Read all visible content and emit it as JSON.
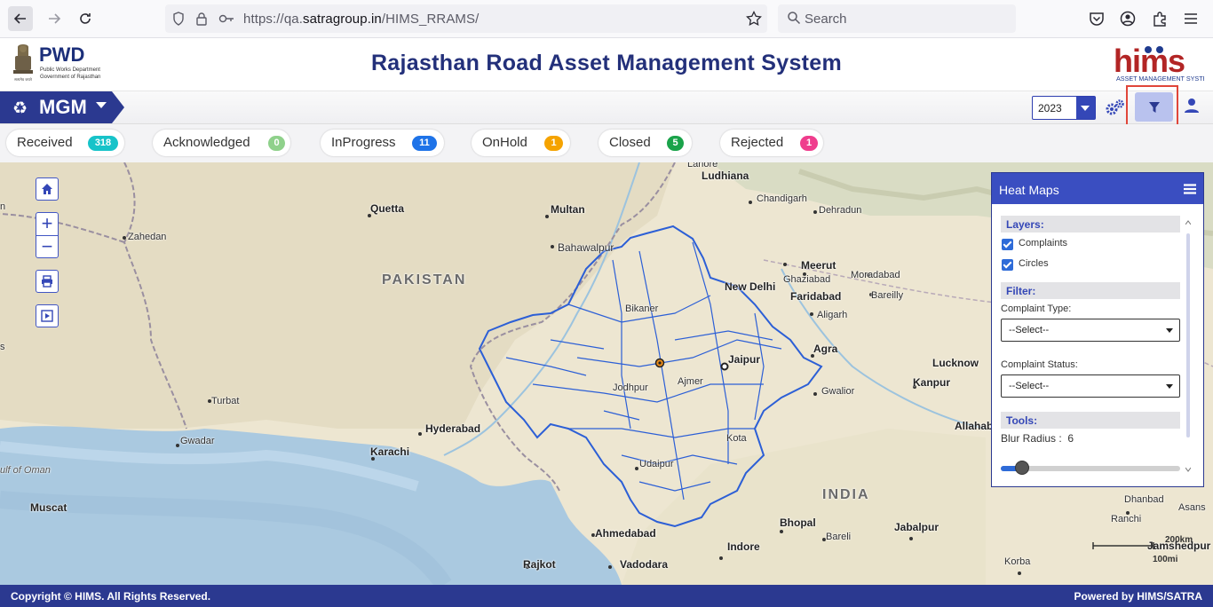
{
  "browser": {
    "url_prefix": "https://qa.",
    "url_domain": "satragroup.in",
    "url_path": "/HIMS_RRAMS/",
    "search_placeholder": "Search"
  },
  "header": {
    "org_name": "PWD",
    "org_sub1": "Public Works Department",
    "org_sub2": "Government of Rajasthan",
    "title": "Rajasthan Road Asset Management System",
    "logo_text": "hims",
    "logo_tagline": "ASSET MANAGEMENT SYSTEM"
  },
  "toolbar": {
    "module": "MGM",
    "year": "2023"
  },
  "statuses": [
    {
      "label": "Received",
      "count": "318",
      "color": "#17c3c9"
    },
    {
      "label": "Acknowledged",
      "count": "0",
      "color": "#8fd18b"
    },
    {
      "label": "InProgress",
      "count": "11",
      "color": "#1e73e8"
    },
    {
      "label": "OnHold",
      "count": "1",
      "color": "#f5a300"
    },
    {
      "label": "Closed",
      "count": "5",
      "color": "#1aa34a"
    },
    {
      "label": "Rejected",
      "count": "1",
      "color": "#ef3d8d"
    }
  ],
  "map": {
    "places": [
      {
        "name": "Ludhiana",
        "bold": true
      },
      {
        "name": "Chandigarh"
      },
      {
        "name": "Dehradun"
      },
      {
        "name": "Quetta",
        "bold": true
      },
      {
        "name": "Multan",
        "bold": true
      },
      {
        "name": "Zahedan"
      },
      {
        "name": "Bahawalpur"
      },
      {
        "name": "PAKISTAN",
        "country": true
      },
      {
        "name": "Meerut",
        "bold": true
      },
      {
        "name": "Moradabad"
      },
      {
        "name": "New Delhi",
        "bold": true
      },
      {
        "name": "Ghaziabad"
      },
      {
        "name": "Faridabad",
        "bold": true
      },
      {
        "name": "Bareilly"
      },
      {
        "name": "Bikaner"
      },
      {
        "name": "Aligarh"
      },
      {
        "name": "Agra",
        "bold": true
      },
      {
        "name": "Jaipur",
        "bold": true
      },
      {
        "name": "Lucknow",
        "bold": true
      },
      {
        "name": "Jodhpur"
      },
      {
        "name": "Ajmer"
      },
      {
        "name": "Kanpur",
        "bold": true
      },
      {
        "name": "Gwalior"
      },
      {
        "name": "Turbat"
      },
      {
        "name": "Hyderabad",
        "bold": true
      },
      {
        "name": "Allahab"
      },
      {
        "name": "Gwadar"
      },
      {
        "name": "Karachi",
        "bold": true
      },
      {
        "name": "Kota"
      },
      {
        "name": "ulf of Oman",
        "sea": true
      },
      {
        "name": "Udaipur"
      },
      {
        "name": "INDIA",
        "country": true
      },
      {
        "name": "Muscat",
        "bold": true
      },
      {
        "name": "Dhanbad"
      },
      {
        "name": "Asans"
      },
      {
        "name": "Ranchi"
      },
      {
        "name": "Ahmedabad",
        "bold": true
      },
      {
        "name": "Bhopal",
        "bold": true
      },
      {
        "name": "Jabalpur",
        "bold": true
      },
      {
        "name": "Bareli"
      },
      {
        "name": "Indore",
        "bold": true
      },
      {
        "name": "Jamshedpur",
        "bold": true
      },
      {
        "name": "Rajkot",
        "bold": true
      },
      {
        "name": "Vadodara",
        "bold": true
      },
      {
        "name": "Korba"
      },
      {
        "name": "Lahore"
      },
      {
        "name": "n"
      },
      {
        "name": "s"
      }
    ],
    "scale_km": "200km",
    "scale_mi": "100mi"
  },
  "heatmaps": {
    "title": "Heat Maps",
    "layers_title": "Layers:",
    "layer_complaints": "Complaints",
    "layer_circles": "Circles",
    "filter_title": "Filter:",
    "complaint_type_label": "Complaint Type:",
    "complaint_type_value": "--Select--",
    "complaint_status_label": "Complaint Status:",
    "complaint_status_value": "--Select--",
    "tools_title": "Tools:",
    "blur_label": "Blur Radius :",
    "blur_value": "6",
    "blur_fraction": 0.12
  },
  "footer": {
    "copyright": "Copyright © HIMS. All Rights Reserved.",
    "powered": "Powered by HIMS/SATRA"
  }
}
